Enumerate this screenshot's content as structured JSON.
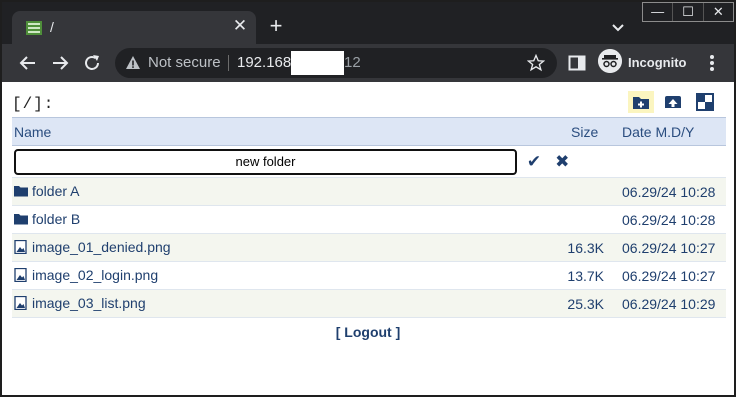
{
  "browser": {
    "tab_title": "/",
    "tab_close": "✕",
    "new_tab": "+",
    "window_controls": {
      "minimize": "—",
      "maximize": "☐",
      "close": "✕"
    },
    "security_label": "Not secure",
    "url_host": "192.168",
    "url_tail": "12",
    "profile_label": "Incognito"
  },
  "page": {
    "path": "[/]:",
    "columns": {
      "name": "Name",
      "size": "Size",
      "date": "Date M.D/Y"
    },
    "new_folder_value": "new folder",
    "confirm_glyph": "✔",
    "cancel_glyph": "✖",
    "rows": [
      {
        "type": "folder",
        "name": "folder A",
        "size": "",
        "date": "06.29/24 10:28"
      },
      {
        "type": "folder",
        "name": "folder B",
        "size": "",
        "date": "06.29/24 10:28"
      },
      {
        "type": "file",
        "name": "image_01_denied.png",
        "size": "16.3K",
        "date": "06.29/24 10:27"
      },
      {
        "type": "file",
        "name": "image_02_login.png",
        "size": "13.7K",
        "date": "06.29/24 10:27"
      },
      {
        "type": "file",
        "name": "image_03_list.png",
        "size": "25.3K",
        "date": "06.29/24 10:29"
      }
    ],
    "logout_label": "[ Logout ]"
  },
  "icons": {
    "new_folder": "folder-plus-icon",
    "upload": "upload-icon",
    "select_all": "checker-icon",
    "folder": "folder-icon",
    "file": "image-file-icon"
  },
  "colors": {
    "link": "#1f3f6e",
    "header_bg": "#dde6f5",
    "odd_row_bg": "#f4f6ef",
    "active_tool_bg": "#fbf5c0"
  }
}
